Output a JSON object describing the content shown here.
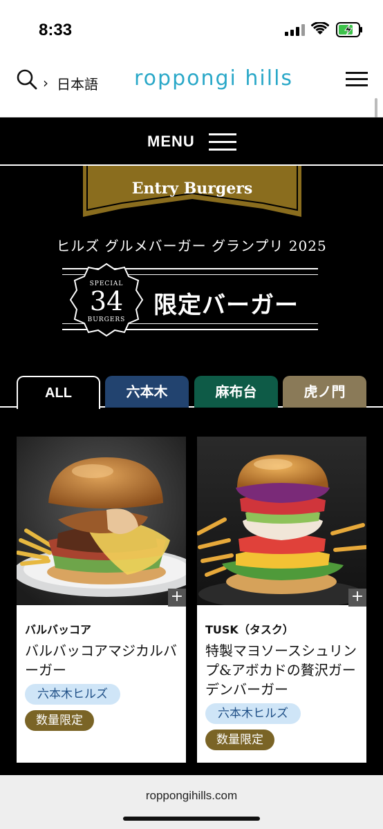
{
  "status_bar": {
    "time": "8:33"
  },
  "header": {
    "language": "日本語",
    "logo": "roppongi hills"
  },
  "menu_bar": {
    "label": "MENU"
  },
  "ribbon": {
    "label": "Entry Burgers"
  },
  "event_title": "ヒルズ グルメバーガー グランプリ 2025",
  "badge": {
    "special": "SPECIAL",
    "count": "34",
    "burgers": "BURGERS",
    "title": "限定バーガー"
  },
  "tabs": [
    {
      "label": "ALL",
      "color": "#000000",
      "active": true
    },
    {
      "label": "六本木",
      "color": "#22436f",
      "active": false
    },
    {
      "label": "麻布台",
      "color": "#0e5b47",
      "active": false
    },
    {
      "label": "虎ノ門",
      "color": "#8a7a58",
      "active": false
    }
  ],
  "cards": [
    {
      "store": "バルバッコア",
      "name": "バルバッコアマジカルバーガー",
      "location": "六本木ヒルズ",
      "tag": "数量限定"
    },
    {
      "store": "TUSK（タスク）",
      "name": "特製マヨソースシュリンプ&アボカドの贅沢ガーデンバーガー",
      "location": "六本木ヒルズ",
      "tag": "数量限定"
    }
  ],
  "browser": {
    "url": "roppongihills.com"
  },
  "colors": {
    "gold": "#8a6d1e",
    "location_pill_bg": "#cfe5f7",
    "limited_pill_bg": "#7a6426",
    "logo_blue": "#2aa8c8"
  }
}
